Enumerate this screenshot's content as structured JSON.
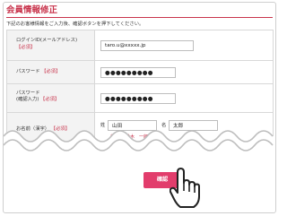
{
  "page": {
    "title": "会員情報修正",
    "instruction": "下記のお客様情報をご入力後、確認ボタンを押下してください。"
  },
  "form": {
    "login_id": {
      "label": "ログインID(メールアドレス)",
      "required": "【必須】",
      "value": "taro.u@xxxxx.jp"
    },
    "password": {
      "label": "パスワード",
      "required": "【必須】",
      "value": "●●●●●●●●●"
    },
    "password_confirm": {
      "label": "パスワード",
      "sub_label": "(確認入力)",
      "required": "【必須】",
      "value": "●●●●●●●●●"
    },
    "name": {
      "label": "お名前（漢字）",
      "required": "【必須】",
      "sei_label": "姓",
      "sei_value": "山田",
      "mei_label": "名",
      "mei_value": "太郎",
      "example": "（全角）鈴木　一郎"
    }
  },
  "actions": {
    "confirm_label": "確認"
  },
  "icons": {
    "cursor": "hand-pointer-icon"
  },
  "colors": {
    "accent": "#c8334b",
    "button": "#e23d6c"
  }
}
